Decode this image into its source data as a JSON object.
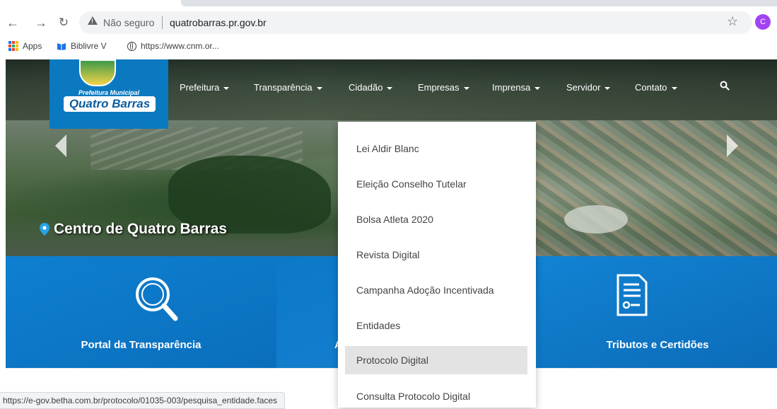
{
  "browser": {
    "security_label": "Não seguro",
    "url": "quatrobarras.pr.gov.br",
    "profile_initial": "C",
    "bookmarks": [
      {
        "label": "Apps",
        "icon": "apps-grid-icon"
      },
      {
        "label": "Biblivre V",
        "icon": "biblivre-icon"
      },
      {
        "label": "https://www.cnm.or...",
        "icon": "globe-icon"
      }
    ],
    "status_url": "https://e-gov.betha.com.br/protocolo/01035-003/pesquisa_entidade.faces"
  },
  "site": {
    "logo_top": "Prefeitura Municipal",
    "logo_name": "Quatro Barras",
    "nav": [
      "Prefeitura",
      "Transparência",
      "Cidadão",
      "Empresas",
      "Imprensa",
      "Servidor",
      "Contato"
    ],
    "hero_caption": "Centro de Quatro Barras",
    "tiles": [
      {
        "label": "Portal da Transparência",
        "icon": "magnifier-icon"
      },
      {
        "label": "A",
        "icon": ""
      },
      {
        "label": "Tributos e Certidões",
        "icon": "document-icon"
      }
    ],
    "dropdown": [
      "Lei Aldir Blanc",
      "Eleição Conselho Tutelar",
      "Bolsa Atleta 2020",
      "Revista Digital",
      "Campanha Adoção Incentivada",
      "Entidades",
      "Protocolo Digital",
      "Consulta Protocolo Digital"
    ],
    "dropdown_active_index": 6
  },
  "colors": {
    "brand_blue": "#0b79c0",
    "tile_blue": "#0e7fd0",
    "avatar": "#a142f4"
  }
}
